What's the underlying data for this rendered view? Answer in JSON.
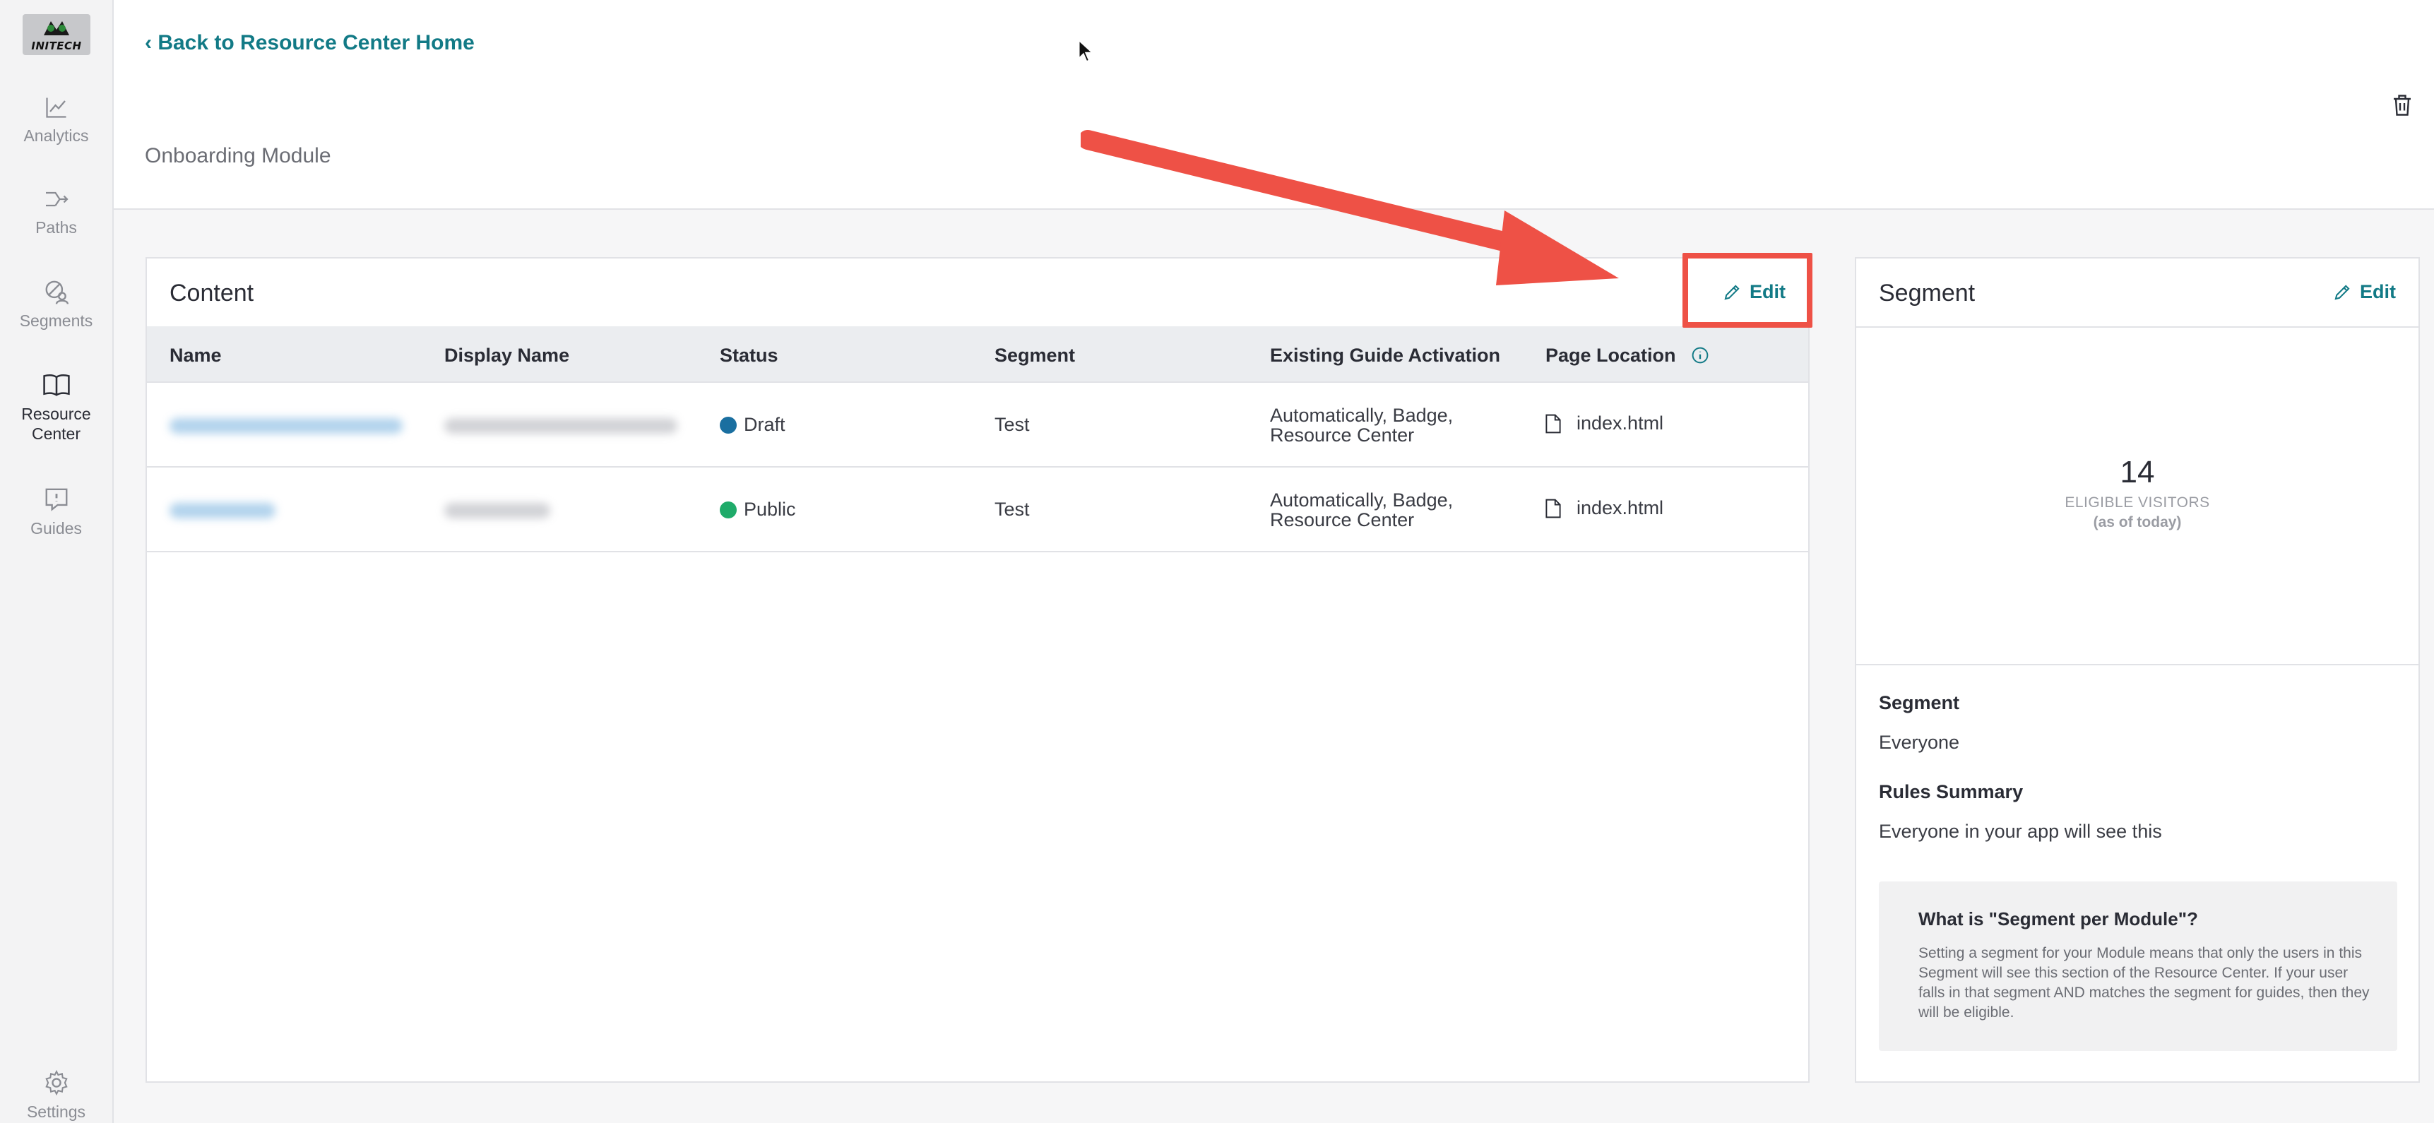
{
  "sidebar": {
    "logo_text": "INITECH",
    "items": [
      {
        "label": "Analytics",
        "icon": "analytics-icon"
      },
      {
        "label": "Paths",
        "icon": "paths-icon"
      },
      {
        "label": "Segments",
        "icon": "segments-icon"
      },
      {
        "label": "Resource Center",
        "icon": "book-icon",
        "active": true
      },
      {
        "label": "Guides",
        "icon": "guides-icon"
      },
      {
        "label": "Settings",
        "icon": "gear-icon"
      }
    ]
  },
  "header": {
    "back_link": "‹ Back to Resource Center Home",
    "module_title": "Onboarding Module"
  },
  "content": {
    "title": "Content",
    "edit_label": "Edit",
    "columns": [
      "Name",
      "Display Name",
      "Status",
      "Segment",
      "Existing Guide Activation",
      "Page Location"
    ],
    "rows": [
      {
        "status": "Draft",
        "status_color": "#1a6fa0",
        "segment": "Test",
        "activation_line1": "Automatically, Badge,",
        "activation_line2": "Resource Center",
        "page": "index.html"
      },
      {
        "status": "Public",
        "status_color": "#1fab6a",
        "segment": "Test",
        "activation_line1": "Automatically, Badge,",
        "activation_line2": "Resource Center",
        "page": "index.html"
      }
    ]
  },
  "segment": {
    "title": "Segment",
    "edit_label": "Edit",
    "count": "14",
    "count_label": "ELIGIBLE VISITORS",
    "count_sub": "(as of today)",
    "segment_label": "Segment",
    "segment_value": "Everyone",
    "rules_label": "Rules Summary",
    "rules_value": "Everyone in your app will see this",
    "info_title": "What is \"Segment per Module\"?",
    "info_body": "Setting a segment for your Module means that only the users in this Segment will see this section of the Resource Center. If your user falls in that segment AND matches the segment for guides, then they will be eligible."
  },
  "colors": {
    "accent": "#127a86",
    "highlight": "#ee5146"
  }
}
